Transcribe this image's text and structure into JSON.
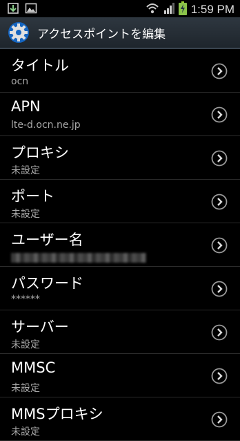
{
  "status": {
    "time": "1:59 PM",
    "left_icons": [
      "download-icon",
      "image-icon"
    ],
    "right_icons": [
      "wifi-icon",
      "signal-icon",
      "battery-charging-icon"
    ]
  },
  "header": {
    "title": "アクセスポイントを編集",
    "icon": "gear-icon"
  },
  "items": [
    {
      "label": "タイトル",
      "value": "ocn"
    },
    {
      "label": "APN",
      "value": "lte-d.ocn.ne.jp"
    },
    {
      "label": "プロキシ",
      "value": "未設定"
    },
    {
      "label": "ポート",
      "value": "未設定"
    },
    {
      "label": "ユーザー名",
      "value": ""
    },
    {
      "label": "パスワード",
      "value": "******"
    },
    {
      "label": "サーバー",
      "value": "未設定"
    },
    {
      "label": "MMSC",
      "value": "未設定"
    },
    {
      "label": "MMSプロキシ",
      "value": "未設定"
    }
  ],
  "colors": {
    "background": "#000000",
    "titlebar": "#2a323a",
    "secondary_text": "#a8a8a8"
  }
}
